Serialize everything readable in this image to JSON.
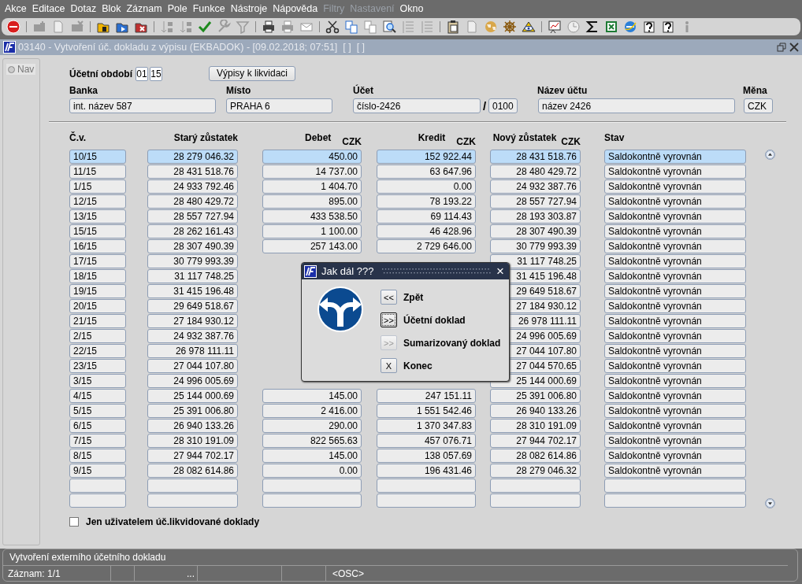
{
  "menu": [
    {
      "label": "Akce",
      "disabled": false
    },
    {
      "label": "Editace",
      "disabled": false
    },
    {
      "label": "Dotaz",
      "disabled": false
    },
    {
      "label": "Blok",
      "disabled": false
    },
    {
      "label": "Záznam",
      "disabled": false
    },
    {
      "label": "Pole",
      "disabled": false
    },
    {
      "label": "Funkce",
      "disabled": false
    },
    {
      "label": "Nástroje",
      "disabled": false
    },
    {
      "label": "Nápověda",
      "disabled": false
    },
    {
      "label": "Filtry",
      "disabled": true
    },
    {
      "label": "Nastavení",
      "disabled": true
    },
    {
      "label": "Okno",
      "disabled": false
    }
  ],
  "toolbar": [
    {
      "kind": "exit",
      "disabled": false
    },
    {
      "kind": "sep"
    },
    {
      "kind": "add",
      "disabled": true
    },
    {
      "kind": "doc",
      "disabled": true
    },
    {
      "kind": "delete",
      "disabled": true
    },
    {
      "kind": "sep"
    },
    {
      "kind": "query",
      "disabled": false
    },
    {
      "kind": "run",
      "disabled": false
    },
    {
      "kind": "cancel",
      "disabled": false
    },
    {
      "kind": "sep"
    },
    {
      "kind": "sort",
      "disabled": true
    },
    {
      "kind": "sort",
      "disabled": true
    },
    {
      "kind": "check",
      "disabled": false
    },
    {
      "kind": "wrench",
      "disabled": true
    },
    {
      "kind": "filter",
      "disabled": true
    },
    {
      "kind": "sep"
    },
    {
      "kind": "print",
      "disabled": false
    },
    {
      "kind": "print",
      "disabled": true
    },
    {
      "kind": "mail",
      "disabled": true
    },
    {
      "kind": "sep"
    },
    {
      "kind": "scissors",
      "disabled": false
    },
    {
      "kind": "copy",
      "disabled": false
    },
    {
      "kind": "copy",
      "disabled": true
    },
    {
      "kind": "search",
      "disabled": false
    },
    {
      "kind": "list",
      "disabled": true
    },
    {
      "kind": "list",
      "disabled": true
    },
    {
      "kind": "sep"
    },
    {
      "kind": "clipboard",
      "disabled": false
    },
    {
      "kind": "doc",
      "disabled": true
    },
    {
      "kind": "globe",
      "disabled": false
    },
    {
      "kind": "wheel",
      "disabled": false
    },
    {
      "kind": "eye",
      "disabled": false
    },
    {
      "kind": "sep"
    },
    {
      "kind": "chart",
      "disabled": false
    },
    {
      "kind": "clock",
      "disabled": true
    },
    {
      "kind": "sigma",
      "disabled": false
    },
    {
      "kind": "excel",
      "disabled": false
    },
    {
      "kind": "browser",
      "disabled": false
    },
    {
      "kind": "help",
      "disabled": false
    },
    {
      "kind": "help",
      "disabled": false
    },
    {
      "kind": "info",
      "disabled": true
    }
  ],
  "window": {
    "title": "03140 - Vytvoření úč. dokladu z výpisu (EKBADOK) - [09.02.2018; 07:51]  [ ]  [ ]"
  },
  "nav": {
    "label": "Nav",
    "selected": false
  },
  "period": {
    "label": "Účetní období",
    "month": "01",
    "year": "15"
  },
  "statements_button": "Výpisy k likvidaci",
  "fields": {
    "bank": {
      "label": "Banka",
      "value": "int. název 587"
    },
    "place": {
      "label": "Místo",
      "value": "PRAHA 6"
    },
    "account": {
      "label": "Účet",
      "value": "číslo-2426",
      "separator": "/",
      "bank_code": "0100"
    },
    "account_name": {
      "label": "Název účtu",
      "value": "název 2426"
    },
    "currency": {
      "label": "Měna",
      "value": "CZK"
    }
  },
  "table": {
    "columns": [
      {
        "label": "Č.v."
      },
      {
        "label": "Starý zůstatek"
      },
      {
        "label": "Debet",
        "unit": "CZK"
      },
      {
        "label": "Kredit",
        "unit": "CZK"
      },
      {
        "label": "Nový zůstatek",
        "unit": "CZK"
      },
      {
        "label": "Stav"
      }
    ],
    "rows": [
      {
        "no": "10/15",
        "old": "28 279 046.32",
        "debit": "450.00",
        "credit": "152 922.44",
        "new": "28 431 518.76",
        "status": "Saldokontně vyrovnán",
        "selected": true
      },
      {
        "no": "11/15",
        "old": "28 431 518.76",
        "debit": "14 737.00",
        "credit": "63 647.96",
        "new": "28 480 429.72",
        "status": "Saldokontně vyrovnán",
        "selected": false
      },
      {
        "no": "1/15",
        "old": "24 933 792.46",
        "debit": "1 404.70",
        "credit": "0.00",
        "new": "24 932 387.76",
        "status": "Saldokontně vyrovnán",
        "selected": false
      },
      {
        "no": "12/15",
        "old": "28 480 429.72",
        "debit": "895.00",
        "credit": "78 193.22",
        "new": "28 557 727.94",
        "status": "Saldokontně vyrovnán",
        "selected": false
      },
      {
        "no": "13/15",
        "old": "28 557 727.94",
        "debit": "433 538.50",
        "credit": "69 114.43",
        "new": "28 193 303.87",
        "status": "Saldokontně vyrovnán",
        "selected": false
      },
      {
        "no": "15/15",
        "old": "28 262 161.43",
        "debit": "1 100.00",
        "credit": "46 428.96",
        "new": "28 307 490.39",
        "status": "Saldokontně vyrovnán",
        "selected": false
      },
      {
        "no": "16/15",
        "old": "28 307 490.39",
        "debit": "257 143.00",
        "credit": "2 729 646.00",
        "new": "30 779 993.39",
        "status": "Saldokontně vyrovnán",
        "selected": false
      },
      {
        "no": "17/15",
        "old": "30 779 993.39",
        "new": "31 117 748.25",
        "status": "Saldokontně vyrovnán",
        "selected": false
      },
      {
        "no": "18/15",
        "old": "31 117 748.25",
        "new": "31 415 196.48",
        "status": "Saldokontně vyrovnán",
        "selected": false
      },
      {
        "no": "19/15",
        "old": "31 415 196.48",
        "new": "29 649 518.67",
        "status": "Saldokontně vyrovnán",
        "selected": false
      },
      {
        "no": "20/15",
        "old": "29 649 518.67",
        "new": "27 184 930.12",
        "status": "Saldokontně vyrovnán",
        "selected": false
      },
      {
        "no": "21/15",
        "old": "27 184 930.12",
        "new": "26 978 111.11",
        "status": "Saldokontně vyrovnán",
        "selected": false
      },
      {
        "no": "2/15",
        "old": "24 932 387.76",
        "new": "24 996 005.69",
        "status": "Saldokontně vyrovnán",
        "selected": false
      },
      {
        "no": "22/15",
        "old": "26 978 111.11",
        "new": "27 044 107.80",
        "status": "Saldokontně vyrovnán",
        "selected": false
      },
      {
        "no": "23/15",
        "old": "27 044 107.80",
        "new": "27 044 570.65",
        "status": "Saldokontně vyrovnán",
        "selected": false
      },
      {
        "no": "3/15",
        "old": "24 996 005.69",
        "new": "25 144 000.69",
        "status": "Saldokontně vyrovnán",
        "selected": false
      },
      {
        "no": "4/15",
        "old": "25 144 000.69",
        "debit": "145.00",
        "credit": "247 151.11",
        "new": "25 391 006.80",
        "status": "Saldokontně vyrovnán",
        "selected": false
      },
      {
        "no": "5/15",
        "old": "25 391 006.80",
        "debit": "2 416.00",
        "credit": "1 551 542.46",
        "new": "26 940 133.26",
        "status": "Saldokontně vyrovnán",
        "selected": false
      },
      {
        "no": "6/15",
        "old": "26 940 133.26",
        "debit": "290.00",
        "credit": "1 370 347.83",
        "new": "28 310 191.09",
        "status": "Saldokontně vyrovnán",
        "selected": false
      },
      {
        "no": "7/15",
        "old": "28 310 191.09",
        "debit": "822 565.63",
        "credit": "457 076.71",
        "new": "27 944 702.17",
        "status": "Saldokontně vyrovnán",
        "selected": false
      },
      {
        "no": "8/15",
        "old": "27 944 702.17",
        "debit": "145.00",
        "credit": "138 057.69",
        "new": "28 082 614.86",
        "status": "Saldokontně vyrovnán",
        "selected": false
      },
      {
        "no": "9/15",
        "old": "28 082 614.86",
        "debit": "0.00",
        "credit": "196 431.46",
        "new": "28 279 046.32",
        "status": "Saldokontně vyrovnán",
        "selected": false
      }
    ]
  },
  "only_user_checkbox": {
    "label": "Jen uživatelem úč.likvidované doklady",
    "checked": false
  },
  "dialog": {
    "title": "Jak dál ???",
    "close": "×",
    "options": [
      {
        "key": "<<",
        "label": "Zpět",
        "focused": false,
        "disabled": false
      },
      {
        "key": ">>",
        "label": "Účetní doklad",
        "focused": true,
        "disabled": false
      },
      {
        "key": ">>",
        "label": "Sumarizovaný doklad",
        "focused": false,
        "disabled": true
      },
      {
        "key": "X",
        "label": "Konec",
        "focused": false,
        "disabled": false
      }
    ]
  },
  "status_bar": {
    "message": "Vytvoření externího účetního dokladu",
    "record": "Záznam: 1/1",
    "cell_3": "...",
    "cell_6": "<OSC>"
  }
}
